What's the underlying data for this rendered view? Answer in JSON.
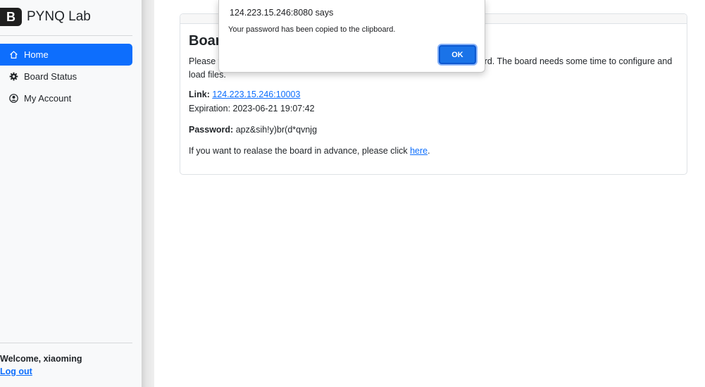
{
  "sidebar": {
    "brand_letter": "B",
    "brand_name": "PYNQ Lab",
    "items": [
      {
        "label": "Home",
        "icon": "house-icon",
        "active": true
      },
      {
        "label": "Board Status",
        "icon": "gear-icon",
        "active": false
      },
      {
        "label": "My Account",
        "icon": "user-circle-icon",
        "active": false
      }
    ],
    "welcome": "Welcome, xiaoming",
    "logout": "Log out"
  },
  "card": {
    "title": "Boar",
    "text_left": "Please w",
    "text_right": "ard. The board needs some time to configure and",
    "text_line2": "load files.",
    "link_label": "Link:",
    "link_value": "124.223.15.246:10003",
    "expiration": "Expiration: 2023-06-21 19:07:42",
    "password_label": "Password:",
    "password_value": "apz&sih!y)br(d*qvnjg",
    "release_text": "If you want to realase the board in advance, please click ",
    "release_link": "here",
    "release_end": "."
  },
  "dialog": {
    "title": "124.223.15.246:8080 says",
    "message": "Your password has been copied to the clipboard.",
    "ok_label": "OK"
  },
  "colors": {
    "accent": "#0d6efd",
    "dialog_button": "#1a73e8",
    "sidebar_bg": "#f8f9fa"
  }
}
